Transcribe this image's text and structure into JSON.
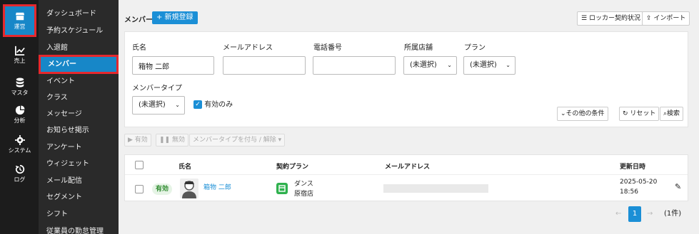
{
  "iconbar": [
    {
      "label": "運営",
      "icon": "store-icon",
      "active": true
    },
    {
      "label": "売上",
      "icon": "chart-icon"
    },
    {
      "label": "マスタ",
      "icon": "database-icon"
    },
    {
      "label": "分析",
      "icon": "pie-icon"
    },
    {
      "label": "システム",
      "icon": "gear-icon"
    },
    {
      "label": "ログ",
      "icon": "history-icon"
    }
  ],
  "menu": [
    "ダッシュボード",
    "予約スケジュール",
    "入退館",
    "メンバー",
    "イベント",
    "クラス",
    "メッセージ",
    "お知らせ掲示",
    "アンケート",
    "ウィジェット",
    "メール配信",
    "セグメント",
    "シフト",
    "従業員の勤怠管理"
  ],
  "header": {
    "title": "メンバー",
    "new_button": "+ 新規登録",
    "locker_button": "ロッカー契約状況",
    "import_button": "インポート"
  },
  "filters": {
    "name_label": "氏名",
    "name_value": "箱物 二郎",
    "email_label": "メールアドレス",
    "email_value": "",
    "phone_label": "電話番号",
    "phone_value": "",
    "store_label": "所属店舗",
    "store_value": "(未選択)",
    "plan_label": "プラン",
    "plan_value": "(未選択)",
    "type_label": "メンバータイプ",
    "type_value": "(未選択)",
    "active_only_label": "有効のみ",
    "active_only_checked": true,
    "more_button": "その他の条件",
    "reset_button": "リセット",
    "search_button": "検索"
  },
  "bulk": {
    "activate": "有効",
    "deactivate": "無効",
    "assign_type": "メンバータイプを付与 / 解除"
  },
  "table": {
    "columns": [
      "氏名",
      "契約プラン",
      "メールアドレス",
      "更新日時"
    ],
    "rows": [
      {
        "status": "有効",
        "name": "箱物 二郎",
        "plan": "ダンス",
        "store": "原宿店",
        "email": "",
        "updated_date": "2025-05-20",
        "updated_time": "18:56"
      }
    ]
  },
  "pagination": {
    "current": "1",
    "total": "(1件)"
  },
  "colors": {
    "accent": "#1b8fd6",
    "highlight": "#e5282d",
    "sidebar": "#1c1c1c",
    "submenu": "#2a2a2a"
  }
}
